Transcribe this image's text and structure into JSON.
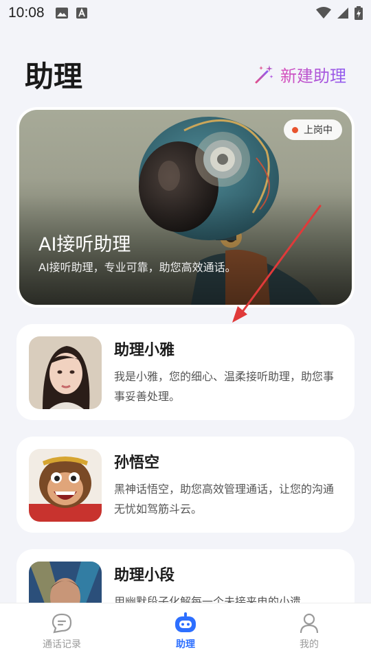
{
  "status_bar": {
    "time": "10:08"
  },
  "header": {
    "title": "助理",
    "new_label": "新建助理"
  },
  "hero": {
    "title": "AI接听助理",
    "subtitle": "AI接听助理，专业可靠，助您高效通话。",
    "status": "上岗中"
  },
  "assistants": [
    {
      "name": "助理小雅",
      "desc": "我是小雅，您的细心、温柔接听助理，助您事事妥善处理。"
    },
    {
      "name": "孙悟空",
      "desc": "黑神话悟空，助您高效管理通话，让您的沟通无忧如驾筋斗云。"
    },
    {
      "name": "助理小段",
      "desc": "用幽默段子化解每一个未接来电的小遗"
    }
  ],
  "nav": [
    {
      "label": "通话记录",
      "icon": "chat-icon"
    },
    {
      "label": "助理",
      "icon": "robot-icon"
    },
    {
      "label": "我的",
      "icon": "person-icon"
    }
  ],
  "colors": {
    "accent": "#2d6fff",
    "status_dot": "#e8542e",
    "arrow": "#e03a3a"
  }
}
